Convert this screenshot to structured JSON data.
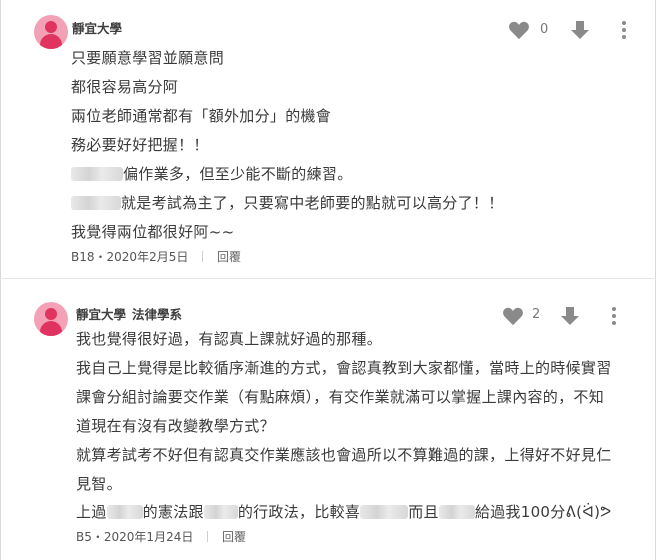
{
  "comments": [
    {
      "author": "靜宜大學",
      "department": "",
      "like_count": "0",
      "lines": [
        "只要願意學習並願意問",
        "都很容易高分阿",
        "兩位老師通常都有「額外加分」的機會",
        "務必要好好把握！！",
        "偏作業多，但至少能不斷的練習。",
        "就是考試為主了，只要寫中老師要的點就可以高分了！！",
        "我覺得兩位都很好阿~~"
      ],
      "floor": "B18",
      "date": "2020年2月5日",
      "reply_label": "回覆"
    },
    {
      "author": "靜宜大學",
      "department": "法律學系",
      "like_count": "2",
      "lines": [
        "我也覺得很好過，有認真上課就好過的那種。",
        "我自己上覺得是比較循序漸進的方式，會認真教到大家都懂，當時上的時候實習",
        "課會分組討論要交作業（有點麻煩），有交作業就滿可以掌握上課內容的，不知",
        "道現在有沒有改變教學方式？",
        "就算考試考不好但有認真交作業應該也會過所以不算難過的課，上得好不好見仁",
        "見智。"
      ],
      "last_line": {
        "part1": "上過",
        "part2": "的憲法跟",
        "part3": "的行政法，比較喜",
        "part4": "而且",
        "part5": "給過我100分ᕕ(ᐛ)ᕗ"
      },
      "floor": "B5",
      "date": "2020年1月24日",
      "reply_label": "回覆"
    }
  ],
  "icons": {
    "like": "heart-icon",
    "dislike": "down-arrow-icon",
    "more": "more-vertical-icon"
  },
  "colors": {
    "avatar_bg": "#f2a1b6",
    "avatar_fg": "#e0335f",
    "icon": "#8a8a8a"
  }
}
